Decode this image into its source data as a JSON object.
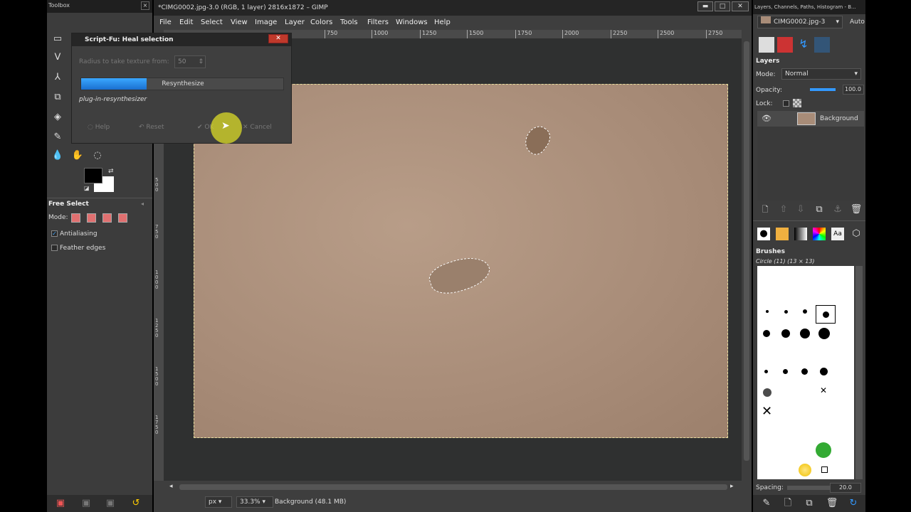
{
  "toolbox": {
    "title": "Toolbox",
    "tool_options_title": "Free Select",
    "mode_label": "Mode:",
    "antialiasing_label": "Antialiasing",
    "antialiasing_checked": true,
    "feather_label": "Feather edges",
    "feather_checked": false
  },
  "window": {
    "title": "*CIMG0002.jpg-3.0 (RGB, 1 layer) 2816x1872 – GIMP",
    "menus": [
      "File",
      "Edit",
      "Select",
      "View",
      "Image",
      "Layer",
      "Colors",
      "Tools",
      "Filters",
      "Windows",
      "Help"
    ],
    "ruler_ticks": [
      "750",
      "1000",
      "1250",
      "1500",
      "1750",
      "2000",
      "2250",
      "2500",
      "2750"
    ],
    "vruler_ticks": [
      "500",
      "750",
      "1000",
      "1250",
      "1500",
      "1750"
    ],
    "status": {
      "unit": "px",
      "zoom": "33.3%",
      "layer_info": "Background (48.1 MB)"
    }
  },
  "dialog": {
    "title": "Script-Fu: Heal selection",
    "radius_label": "Radius to take texture from:",
    "radius_value": "50",
    "progress_label": "Resynthesize",
    "progress_fraction": 0.32,
    "plugin_name": "plug-in-resynthesizer",
    "buttons": [
      "Help",
      "Reset",
      "OK",
      "Cancel"
    ]
  },
  "dock": {
    "title": "Layers, Channels, Paths, Histogram - B...",
    "image_selector": "CIMG0002.jpg-3",
    "auto_label": "Auto",
    "layers_title": "Layers",
    "mode_label": "Mode:",
    "mode_value": "Normal",
    "opacity_label": "Opacity:",
    "opacity_value": "100.0",
    "lock_label": "Lock:",
    "layer_name": "Background",
    "brushes_title": "Brushes",
    "brush_name": "Circle (11) (13 × 13)",
    "spacing_label": "Spacing:",
    "spacing_value": "20.0"
  },
  "colors": {
    "fg": "#000000",
    "bg": "#ffffff",
    "selection": "#ffffff",
    "progress": "#1a6fd0"
  }
}
